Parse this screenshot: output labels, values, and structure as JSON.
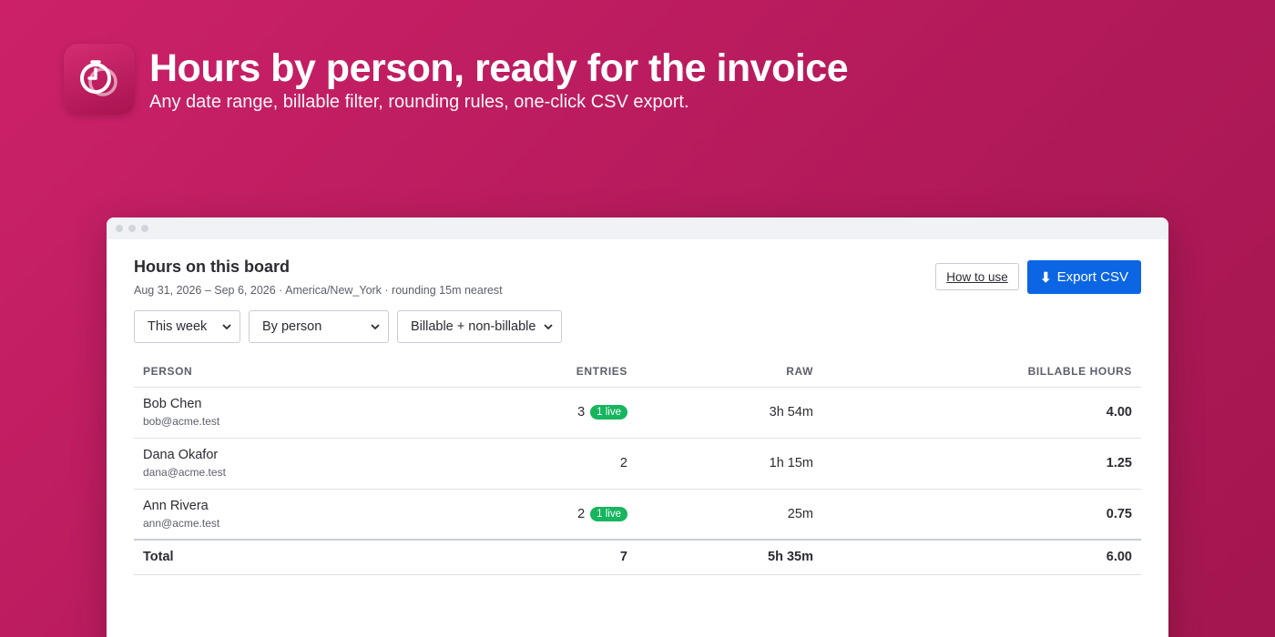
{
  "hero": {
    "title": "Hours by person, ready for the invoice",
    "subtitle": "Any date range, billable filter, rounding rules, one-click CSV export.",
    "icon": "clock-icon"
  },
  "panel": {
    "title": "Hours on this board",
    "meta": "Aug 31, 2026 – Sep 6, 2026 · America/New_York · rounding 15m nearest",
    "how_to_label": "How to use",
    "export_label": "Export CSV",
    "export_icon": "download-arrow-icon"
  },
  "filters": {
    "range": "This week",
    "group": "By person",
    "billable": "Billable + non-billable"
  },
  "table": {
    "headers": {
      "person": "PERSON",
      "entries": "ENTRIES",
      "raw": "RAW",
      "billable": "BILLABLE HOURS"
    },
    "rows": [
      {
        "name": "Bob Chen",
        "email": "bob@acme.test",
        "entries": "3",
        "live": "1 live",
        "raw": "3h 54m",
        "billable": "4.00"
      },
      {
        "name": "Dana Okafor",
        "email": "dana@acme.test",
        "entries": "2",
        "live": "",
        "raw": "1h 15m",
        "billable": "1.25"
      },
      {
        "name": "Ann Rivera",
        "email": "ann@acme.test",
        "entries": "2",
        "live": "1 live",
        "raw": "25m",
        "billable": "0.75"
      }
    ],
    "total": {
      "label": "Total",
      "entries": "7",
      "raw": "5h 35m",
      "billable": "6.00"
    }
  },
  "colors": {
    "background": "#c01e62",
    "accent": "#0c66e4",
    "live_badge": "#16b55e"
  }
}
